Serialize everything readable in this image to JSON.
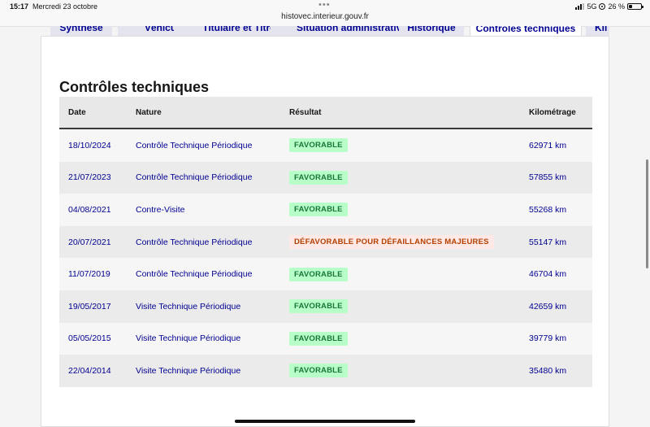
{
  "status_bar": {
    "time": "15:17",
    "date": "Mercredi 23 octobre",
    "url": "histovec.interieur.gouv.fr",
    "network": "5G",
    "battery": "26 %",
    "battery_level": 0.26
  },
  "tabs": [
    {
      "label": "Synthèse"
    },
    {
      "label": "Véhicule"
    },
    {
      "label": "Titulaire et Titre"
    },
    {
      "label": "Situation administrative"
    },
    {
      "label": "Historique"
    },
    {
      "label": "Contrôles techniques"
    },
    {
      "label": "Kil"
    }
  ],
  "section": {
    "title": "Contrôles techniques",
    "columns": {
      "date": "Date",
      "nature": "Nature",
      "resultat": "Résultat",
      "kilometrage": "Kilométrage"
    },
    "rows": [
      {
        "date": "18/10/2024",
        "nature": "Contrôle Technique Périodique",
        "resultat": "FAVORABLE",
        "status": "ok",
        "km": "62971 km"
      },
      {
        "date": "21/07/2023",
        "nature": "Contrôle Technique Périodique",
        "resultat": "FAVORABLE",
        "status": "ok",
        "km": "57855 km"
      },
      {
        "date": "04/08/2021",
        "nature": "Contre-Visite",
        "resultat": "FAVORABLE",
        "status": "ok",
        "km": "55268 km"
      },
      {
        "date": "20/07/2021",
        "nature": "Contrôle Technique Périodique",
        "resultat": "DÉFAVORABLE POUR DÉFAILLANCES MAJEURES",
        "status": "ko",
        "km": "55147 km"
      },
      {
        "date": "11/07/2019",
        "nature": "Contrôle Technique Périodique",
        "resultat": "FAVORABLE",
        "status": "ok",
        "km": "46704 km"
      },
      {
        "date": "19/05/2017",
        "nature": "Visite Technique Périodique",
        "resultat": "FAVORABLE",
        "status": "ok",
        "km": "42659 km"
      },
      {
        "date": "05/05/2015",
        "nature": "Visite Technique Périodique",
        "resultat": "FAVORABLE",
        "status": "ok",
        "km": "39779 km"
      },
      {
        "date": "22/04/2014",
        "nature": "Visite Technique Périodique",
        "resultat": "FAVORABLE",
        "status": "ok",
        "km": "35480 km"
      }
    ]
  },
  "colors": {
    "link": "#000091",
    "favorable_bg": "#b8fec9",
    "favorable_text": "#18753c",
    "defavorable_bg": "#ffe9e6",
    "defavorable_text": "#b34000"
  }
}
